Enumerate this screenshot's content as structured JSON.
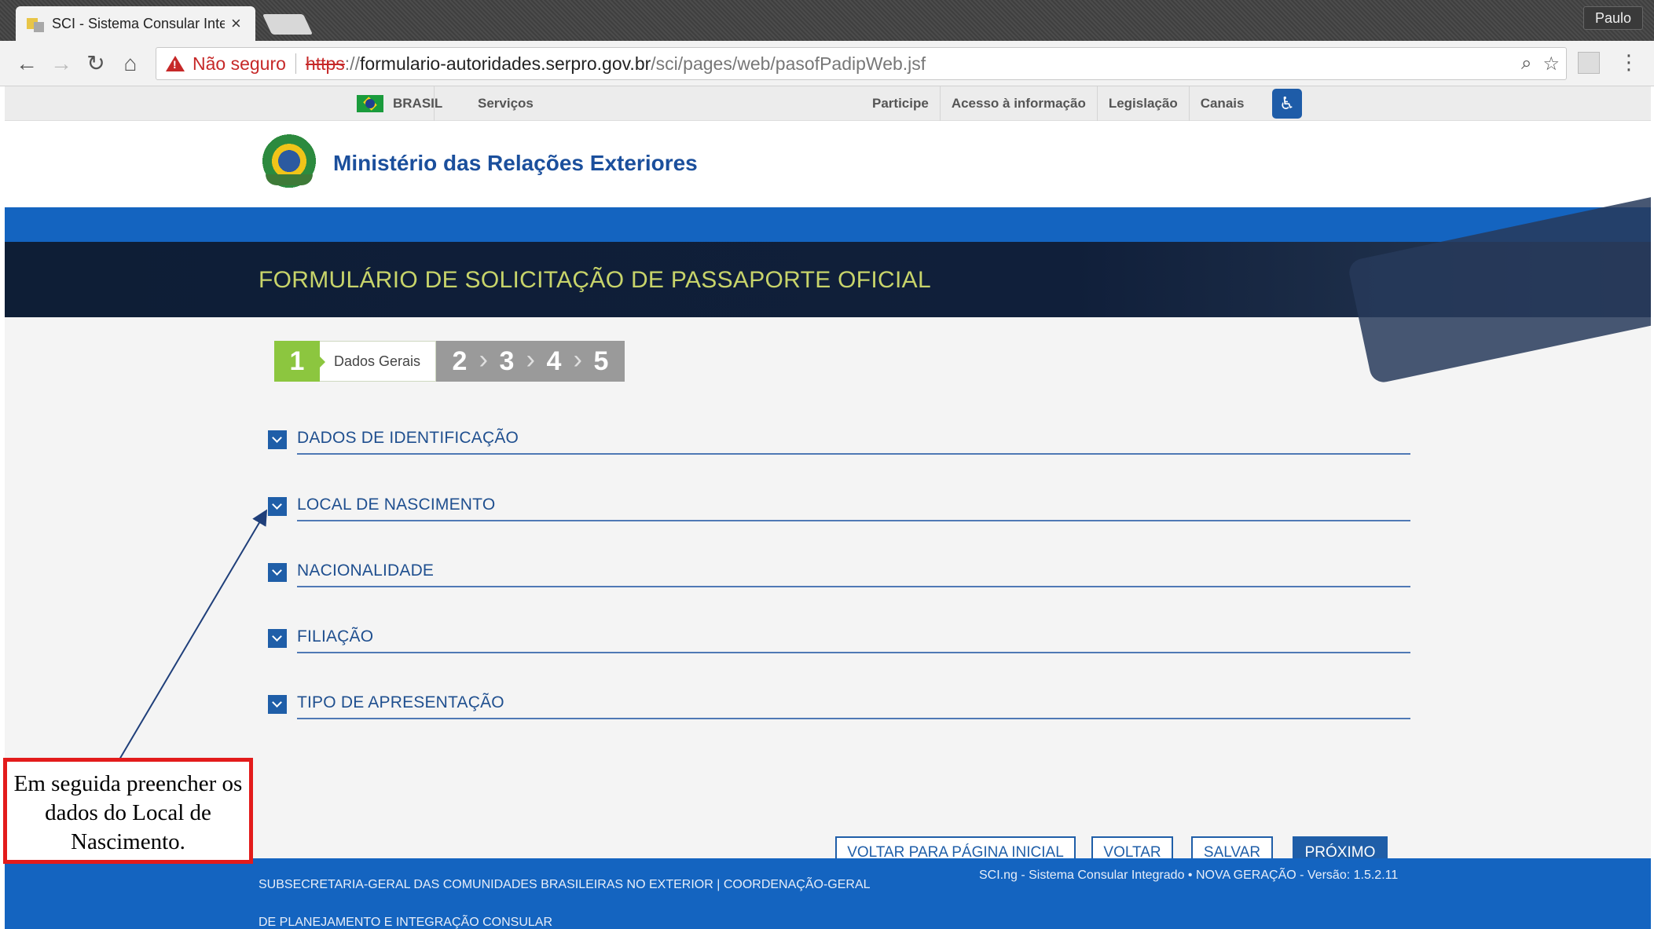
{
  "browser": {
    "tab_title": "SCI - Sistema Consular Inte",
    "tab_close": "×",
    "profile": "Paulo",
    "nav": {
      "back": "←",
      "forward": "→",
      "reload": "↻",
      "home": "⌂",
      "menu": "⋮"
    },
    "security_label": "Não seguro",
    "url_scheme": "https",
    "url_sep": "://",
    "url_host": "formulario-autoridades.serpro.gov.br",
    "url_path": "/sci/pages/web/pasofPadipWeb.jsf",
    "zoom_glyph": "⌕",
    "star_glyph": "☆"
  },
  "govbar": {
    "brasil": "BRASIL",
    "servicos": "Serviços",
    "links": [
      "Participe",
      "Acesso à informação",
      "Legislação",
      "Canais"
    ],
    "access_glyph": "♿"
  },
  "header": {
    "ministry": "Ministério das Relações Exteriores"
  },
  "form": {
    "title": "FORMULÁRIO DE SOLICITAÇÃO DE PASSAPORTE OFICIAL",
    "steps": {
      "active": "1",
      "active_label": "Dados Gerais",
      "others": [
        "2",
        "3",
        "4",
        "5"
      ]
    },
    "sections": [
      "DADOS DE IDENTIFICAÇÃO",
      "LOCAL DE NASCIMENTO",
      "NACIONALIDADE",
      "FILIAÇÃO",
      "TIPO DE APRESENTAÇÃO"
    ],
    "buttons": {
      "home": "VOLTAR PARA PÁGINA INICIAL",
      "back": "VOLTAR",
      "save": "SALVAR",
      "next": "PRÓXIMO"
    }
  },
  "footer": {
    "left": "SUBSECRETARIA-GERAL DAS COMUNIDADES BRASILEIRAS NO EXTERIOR | COORDENAÇÃO-GERAL DE PLANEJAMENTO E INTEGRAÇÃO CONSULAR",
    "right": "SCI.ng - Sistema Consular Integrado • NOVA GERAÇÃO - Versão: 1.5.2.11"
  },
  "annotation": {
    "text": "Em seguida preencher os dados do Local de Nascimento."
  },
  "colors": {
    "accent": "#1464c0",
    "step_active": "#8cc63f",
    "callout_border": "#e31b1b",
    "title_text": "#c8d46a"
  }
}
